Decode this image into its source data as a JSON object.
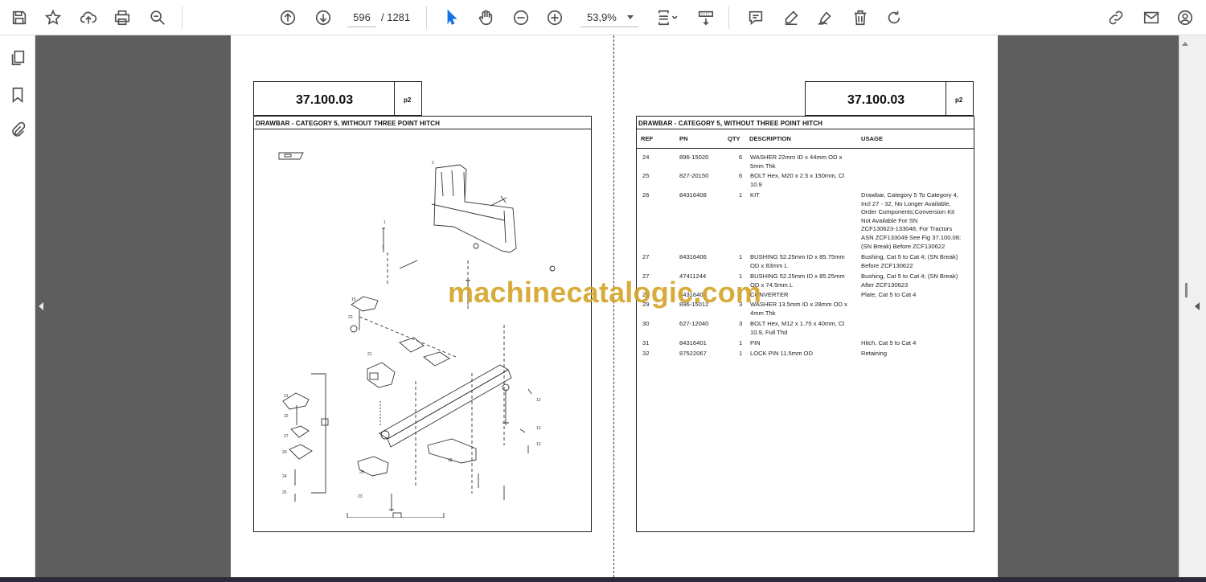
{
  "toolbar": {
    "current_page": "596",
    "total_pages": "/  1281",
    "zoom": "53,9%"
  },
  "document": {
    "code": "37.100.03",
    "page_label": "p2",
    "section_title": "DRAWBAR - CATEGORY 5, WITHOUT THREE POINT HITCH",
    "table_headers": {
      "ref": "REF",
      "pn": "PN",
      "qty": "QTY",
      "desc": "DESCRIPTION",
      "usage": "USAGE"
    },
    "rows": [
      {
        "ref": "24",
        "pn": "896-15020",
        "qty": "6",
        "desc": [
          "WASHER 22mm ID x 44mm OD x",
          "5mm Thk"
        ],
        "usage": []
      },
      {
        "ref": "25",
        "pn": "827-20150",
        "qty": "6",
        "desc": [
          "BOLT Hex, M20 x 2.5 x 150mm, Cl",
          "10.9"
        ],
        "usage": []
      },
      {
        "ref": "26",
        "pn": "84316408",
        "qty": "1",
        "desc": [
          "KIT"
        ],
        "usage": [
          "Drawbar, Category 5 To Category 4,",
          "Incl 27 - 32, No Longer Available,",
          "Order Components;Conversion Kit",
          "Not Available For SN",
          "ZCF130623-133048, For Tractors",
          "ASN ZCF133049 See Fig 37.100.08;",
          "(SN Break) Before ZCF130622"
        ]
      },
      {
        "ref": "27",
        "pn": "84316406",
        "qty": "1",
        "desc": [
          "BUSHING 52.25mm ID x 85.75mm",
          "OD x 83mm L"
        ],
        "usage": [
          "Bushing, Cat 5 to Cat 4; (SN Break)",
          "Before ZCF130622"
        ]
      },
      {
        "ref": "27",
        "pn": "47411244",
        "qty": "1",
        "desc": [
          "BUSHING 52.25mm ID x 85.25mm",
          "OD x 74.5mm L"
        ],
        "usage": [
          "Bushing, Cat 5  to Cat 4; (SN Break)",
          "After ZCF130623"
        ]
      },
      {
        "ref": "28",
        "pn": "84316407",
        "qty": "1",
        "desc": [
          "CONVERTER"
        ],
        "usage": [
          "Plate, Cat 5 to Cat 4"
        ]
      },
      {
        "ref": "29",
        "pn": "896-15012",
        "qty": "3",
        "desc": [
          "WASHER 13.5mm ID x 28mm OD x",
          "4mm Thk"
        ],
        "usage": []
      },
      {
        "ref": "30",
        "pn": "627-12040",
        "qty": "3",
        "desc": [
          "BOLT Hex, M12 x 1.75 x 40mm, Cl",
          "10.9, Full Thd"
        ],
        "usage": []
      },
      {
        "ref": "31",
        "pn": "84316401",
        "qty": "1",
        "desc": [
          "PIN"
        ],
        "usage": [
          "Hitch, Cat 5 to Cat 4"
        ]
      },
      {
        "ref": "32",
        "pn": "87522067",
        "qty": "1",
        "desc": [
          "LOCK PIN 11.5mm OD"
        ],
        "usage": [
          "Retaining"
        ]
      }
    ]
  },
  "watermark": "machinecatalogic.com",
  "icons": [
    "save-icon",
    "bookmark-star-icon",
    "upload-icon",
    "print-icon",
    "zoom-search-icon",
    "prev-page-icon",
    "next-page-icon",
    "select-cursor-icon",
    "hand-icon",
    "zoom-out-icon",
    "zoom-in-icon",
    "fit-page-icon",
    "scroll-mode-icon",
    "comment-icon",
    "highlight-icon",
    "sign-icon",
    "delete-icon",
    "rotate-icon",
    "link-icon",
    "mail-icon",
    "account-icon",
    "pages-icon",
    "bookmarks-icon",
    "attachments-icon"
  ]
}
